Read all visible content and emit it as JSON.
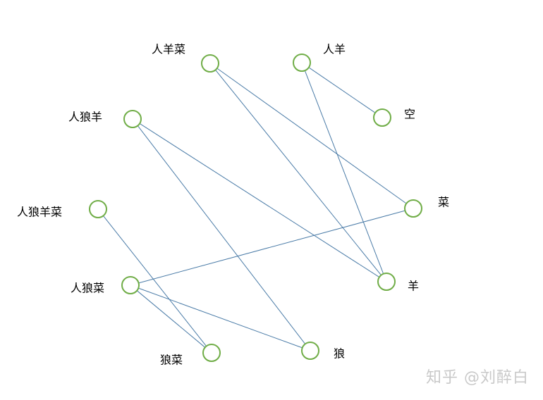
{
  "nodes": [
    {
      "id": "rys",
      "label": "人羊菜"
    },
    {
      "id": "ry",
      "label": "人羊"
    },
    {
      "id": "kong",
      "label": "空"
    },
    {
      "id": "rly",
      "label": "人狼羊"
    },
    {
      "id": "cai",
      "label": "菜"
    },
    {
      "id": "rlyc",
      "label": "人狼羊菜"
    },
    {
      "id": "yang",
      "label": "羊"
    },
    {
      "id": "rlc",
      "label": "人狼菜"
    },
    {
      "id": "lc",
      "label": "狼菜"
    },
    {
      "id": "lang",
      "label": "狼"
    }
  ],
  "edges": [
    [
      "rys",
      "cai"
    ],
    [
      "rys",
      "yang"
    ],
    [
      "ry",
      "kong"
    ],
    [
      "ry",
      "yang"
    ],
    [
      "rly",
      "yang"
    ],
    [
      "rly",
      "lang"
    ],
    [
      "rlyc",
      "lc"
    ],
    [
      "rlc",
      "cai"
    ],
    [
      "rlc",
      "lc"
    ],
    [
      "rlc",
      "lang"
    ]
  ],
  "watermark": "知乎 @刘醉白"
}
